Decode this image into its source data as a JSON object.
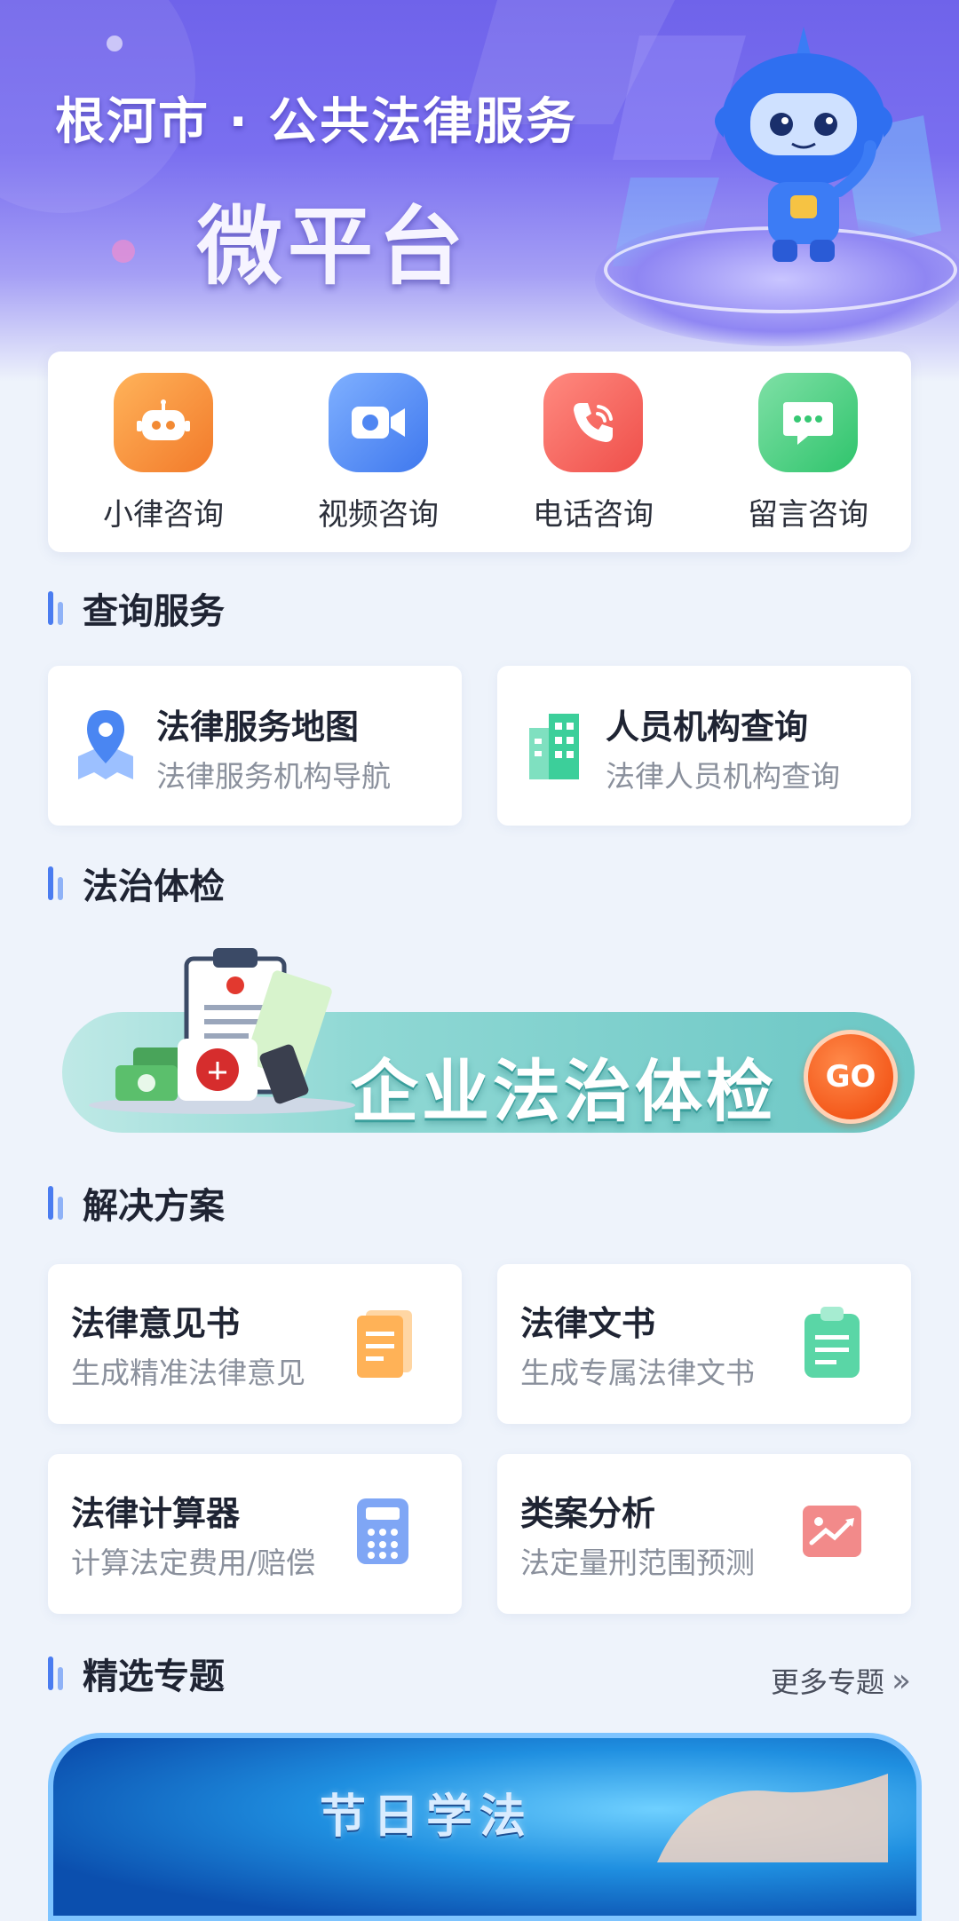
{
  "banner": {
    "title": "根河市 · 公共法律服务",
    "subtitle": "微平台"
  },
  "quick_actions": [
    {
      "label": "小律咨询",
      "icon": "robot-icon",
      "color": "#f7953a"
    },
    {
      "label": "视频咨询",
      "icon": "video-camera-icon",
      "color": "#4f8ef5"
    },
    {
      "label": "电话咨询",
      "icon": "phone-icon",
      "color": "#f2645a"
    },
    {
      "label": "留言咨询",
      "icon": "message-icon",
      "color": "#3fcf7d"
    }
  ],
  "sections": {
    "query": "查询服务",
    "health": "法治体检",
    "solutions": "解决方案",
    "featured": "精选专题"
  },
  "query_cards": [
    {
      "title": "法律服务地图",
      "subtitle": "法律服务机构导航",
      "icon": "map-pin-icon"
    },
    {
      "title": "人员机构查询",
      "subtitle": "法律人员机构查询",
      "icon": "building-icon"
    }
  ],
  "health_check": {
    "text": "企业法治体检",
    "go": "GO"
  },
  "solution_cards": [
    {
      "title": "法律意见书",
      "subtitle": "生成精准法律意见",
      "icon": "document-icon"
    },
    {
      "title": "法律文书",
      "subtitle": "生成专属法律文书",
      "icon": "clipboard-icon"
    },
    {
      "title": "法律计算器",
      "subtitle": "计算法定费用/赔偿",
      "icon": "calculator-icon"
    },
    {
      "title": "类案分析",
      "subtitle": "法定量刑范围预测",
      "icon": "chart-icon"
    }
  ],
  "featured": {
    "more_label": "更多专题",
    "banner_text": "节日学法"
  },
  "colors": {
    "accent_blue": "#4a7cf0",
    "accent_light": "#8fb2f7",
    "teal": "#6cc7c5"
  }
}
